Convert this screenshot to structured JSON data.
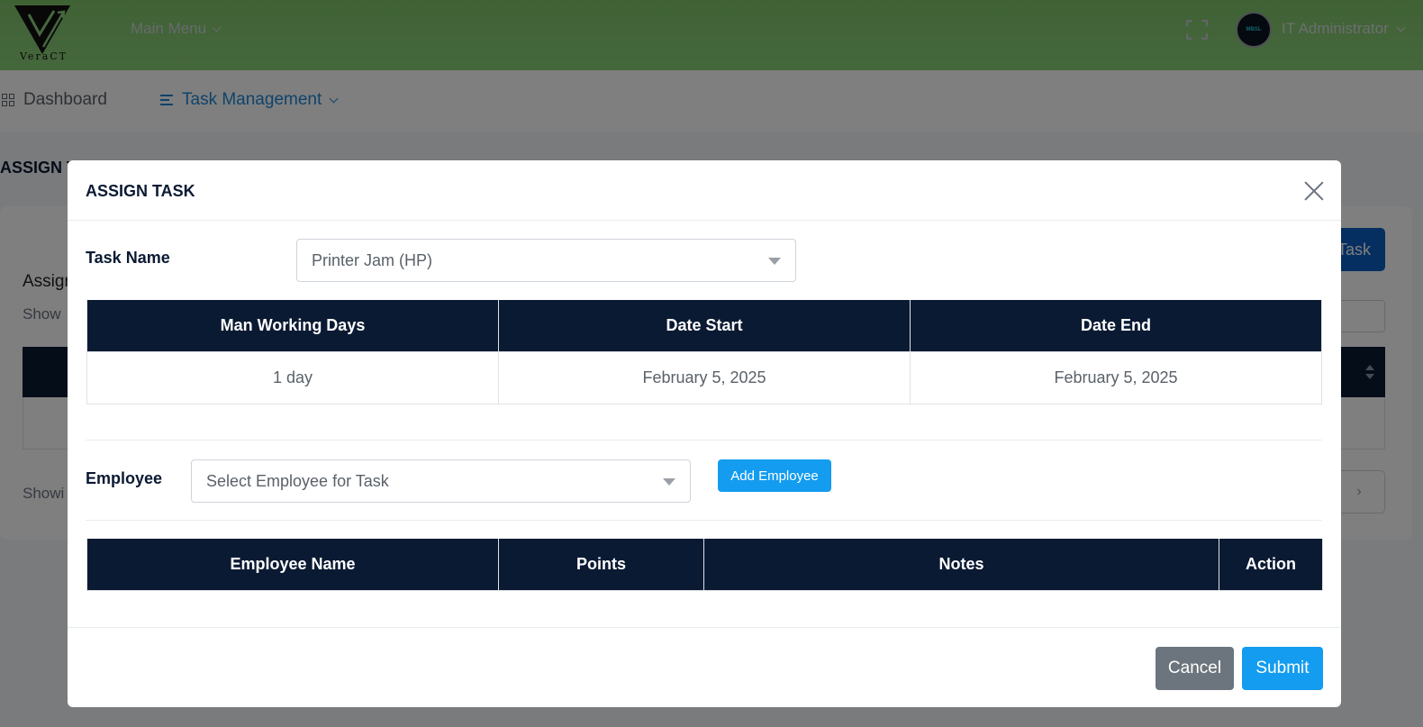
{
  "app": {
    "logo_text": "VeraCT",
    "main_menu_label": "Main Menu",
    "user_name": "IT Administrator",
    "avatar_text": "MBSL"
  },
  "navbar": {
    "items": [
      {
        "label": "Dashboard",
        "icon": "grid-icon",
        "active": false
      },
      {
        "label": "Task Management",
        "icon": "menu-icon",
        "active": true
      }
    ]
  },
  "background_page": {
    "page_title": "ASSIGN TASK",
    "card_title": "Assign",
    "show_entries": "Show",
    "add_button": "Task",
    "showing_text": "Showi",
    "pager_next": "›"
  },
  "modal": {
    "title": "ASSIGN TASK",
    "task_name_label": "Task Name",
    "task_name_value": "Printer Jam (HP)",
    "schedule_table": {
      "headers": [
        "Man Working Days",
        "Date Start",
        "Date End"
      ],
      "rows": [
        [
          "1 day",
          "February 5, 2025",
          "February 5, 2025"
        ]
      ]
    },
    "employee_label": "Employee",
    "employee_placeholder": "Select Employee for Task",
    "add_employee_label": "Add Employee",
    "employee_table": {
      "headers": [
        "Employee Name",
        "Points",
        "Notes",
        "Action"
      ],
      "rows": []
    },
    "cancel_label": "Cancel",
    "submit_label": "Submit"
  },
  "colors": {
    "header_green": "#8ccf7a",
    "table_header": "#0b1a33",
    "primary_blue": "#139cf0",
    "secondary_gray": "#6c757d",
    "nav_active": "#1f86d6"
  }
}
